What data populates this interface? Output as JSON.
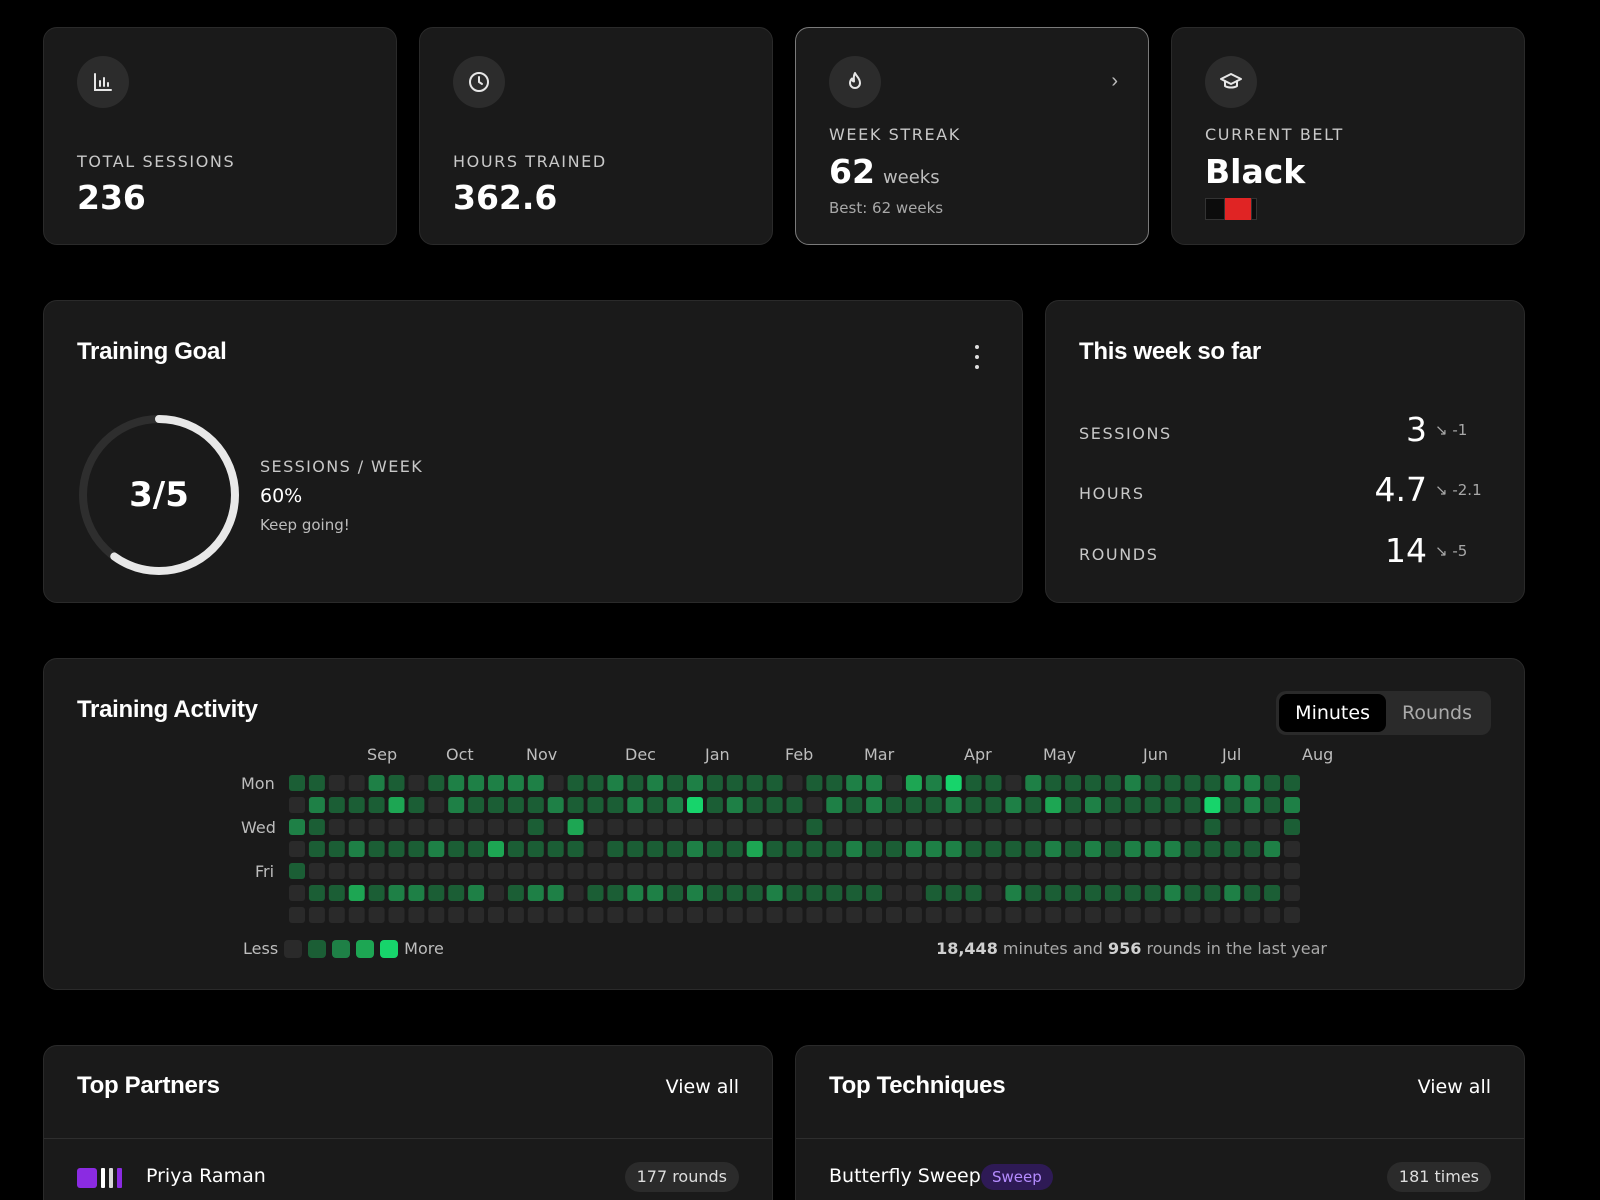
{
  "stats": {
    "sessions": {
      "label": "TOTAL SESSIONS",
      "value": "236",
      "icon": "bar-chart-icon"
    },
    "hours": {
      "label": "HOURS TRAINED",
      "value": "362.6",
      "icon": "clock-icon"
    },
    "streak": {
      "label": "WEEK STREAK",
      "value": "62",
      "unit": "weeks",
      "sub": "Best: 62 weeks",
      "icon": "flame-icon"
    },
    "belt": {
      "label": "CURRENT BELT",
      "value": "Black",
      "icon": "graduation-cap-icon",
      "colors": [
        "#0c0c0c",
        "#e02424"
      ]
    }
  },
  "goal": {
    "title": "Training Goal",
    "progress_text": "3/5",
    "fraction": 0.6,
    "label": "SESSIONS / WEEK",
    "percent": "60%",
    "message": "Keep going!"
  },
  "week": {
    "title": "This week so far",
    "rows": [
      {
        "label": "SESSIONS",
        "value": "3",
        "delta": "-1"
      },
      {
        "label": "HOURS",
        "value": "4.7",
        "delta": "-2.1"
      },
      {
        "label": "ROUNDS",
        "value": "14",
        "delta": "-5"
      }
    ]
  },
  "activity": {
    "title": "Training Activity",
    "toggle": {
      "options": [
        "Minutes",
        "Rounds"
      ],
      "active": "Minutes"
    },
    "months": [
      "Sep",
      "Oct",
      "Nov",
      "Dec",
      "Jan",
      "Feb",
      "Mar",
      "Apr",
      "May",
      "Jun",
      "Jul",
      "Aug"
    ],
    "month_week_index": [
      4,
      8,
      12,
      17,
      21,
      25,
      29,
      34,
      38,
      43,
      47,
      51
    ],
    "day_labels": [
      "Mon",
      "Wed",
      "Fri"
    ],
    "legend": {
      "less": "Less",
      "more": "More"
    },
    "palette": [
      "#2a2a2a",
      "#1b5e35",
      "#1e8046",
      "#1da653",
      "#17d46b"
    ],
    "summary": {
      "minutes": "18,448",
      "rounds": "956",
      "text_mid": "minutes and",
      "text_end": "rounds in the last year"
    },
    "weeks": [
      [
        1,
        0,
        2,
        0,
        1,
        0,
        0
      ],
      [
        1,
        2,
        1,
        1,
        0,
        1,
        0
      ],
      [
        0,
        1,
        0,
        1,
        0,
        1,
        0
      ],
      [
        0,
        1,
        0,
        2,
        0,
        3,
        0
      ],
      [
        2,
        1,
        0,
        1,
        0,
        1,
        0
      ],
      [
        1,
        3,
        0,
        1,
        0,
        2,
        0
      ],
      [
        0,
        1,
        0,
        1,
        0,
        2,
        0
      ],
      [
        1,
        0,
        0,
        2,
        0,
        1,
        0
      ],
      [
        2,
        2,
        0,
        1,
        0,
        1,
        0
      ],
      [
        2,
        1,
        0,
        1,
        0,
        2,
        0
      ],
      [
        2,
        1,
        0,
        3,
        0,
        0,
        0
      ],
      [
        2,
        1,
        0,
        1,
        0,
        1,
        0
      ],
      [
        2,
        1,
        1,
        1,
        0,
        2,
        0
      ],
      [
        0,
        2,
        0,
        1,
        0,
        2,
        0
      ],
      [
        1,
        1,
        3,
        1,
        0,
        0,
        0
      ],
      [
        1,
        1,
        0,
        0,
        0,
        1,
        0
      ],
      [
        2,
        1,
        0,
        1,
        0,
        1,
        0
      ],
      [
        1,
        2,
        0,
        1,
        0,
        2,
        0
      ],
      [
        2,
        1,
        0,
        1,
        0,
        2,
        0
      ],
      [
        1,
        2,
        0,
        1,
        0,
        1,
        0
      ],
      [
        2,
        4,
        0,
        2,
        0,
        2,
        0
      ],
      [
        1,
        1,
        0,
        1,
        0,
        1,
        0
      ],
      [
        1,
        2,
        0,
        1,
        0,
        1,
        0
      ],
      [
        1,
        1,
        0,
        3,
        0,
        1,
        0
      ],
      [
        1,
        1,
        0,
        1,
        0,
        2,
        0
      ],
      [
        0,
        1,
        0,
        1,
        0,
        1,
        0
      ],
      [
        1,
        0,
        1,
        1,
        0,
        1,
        0
      ],
      [
        1,
        2,
        0,
        1,
        0,
        1,
        0
      ],
      [
        2,
        1,
        0,
        2,
        0,
        1,
        0
      ],
      [
        2,
        2,
        0,
        1,
        0,
        1,
        0
      ],
      [
        0,
        1,
        0,
        1,
        0,
        0,
        0
      ],
      [
        3,
        1,
        0,
        2,
        0,
        0,
        0
      ],
      [
        2,
        1,
        0,
        2,
        0,
        1,
        0
      ],
      [
        4,
        2,
        0,
        2,
        0,
        1,
        0
      ],
      [
        1,
        1,
        0,
        1,
        0,
        1,
        0
      ],
      [
        1,
        1,
        0,
        1,
        0,
        0,
        0
      ],
      [
        0,
        2,
        0,
        1,
        0,
        2,
        0
      ],
      [
        2,
        1,
        0,
        1,
        0,
        1,
        0
      ],
      [
        1,
        3,
        0,
        2,
        0,
        1,
        0
      ],
      [
        1,
        1,
        0,
        1,
        0,
        1,
        0
      ],
      [
        1,
        2,
        0,
        2,
        0,
        1,
        0
      ],
      [
        1,
        1,
        0,
        1,
        0,
        1,
        0
      ],
      [
        2,
        1,
        0,
        2,
        0,
        1,
        0
      ],
      [
        1,
        1,
        0,
        2,
        0,
        1,
        0
      ],
      [
        1,
        1,
        0,
        2,
        0,
        2,
        0
      ],
      [
        1,
        1,
        0,
        1,
        0,
        1,
        0
      ],
      [
        1,
        4,
        1,
        1,
        0,
        1,
        0
      ],
      [
        2,
        1,
        0,
        1,
        0,
        2,
        0
      ],
      [
        2,
        2,
        0,
        1,
        0,
        1,
        0
      ],
      [
        1,
        1,
        0,
        2,
        0,
        1,
        0
      ],
      [
        1,
        2,
        1,
        0,
        0,
        0,
        0
      ]
    ]
  },
  "partners": {
    "title": "Top Partners",
    "view_all": "View all",
    "first": {
      "name": "Priya Raman",
      "count": "177 rounds"
    }
  },
  "techniques": {
    "title": "Top Techniques",
    "view_all": "View all",
    "first": {
      "name": "Butterfly Sweep",
      "tag": "Sweep",
      "count": "181 times"
    }
  }
}
